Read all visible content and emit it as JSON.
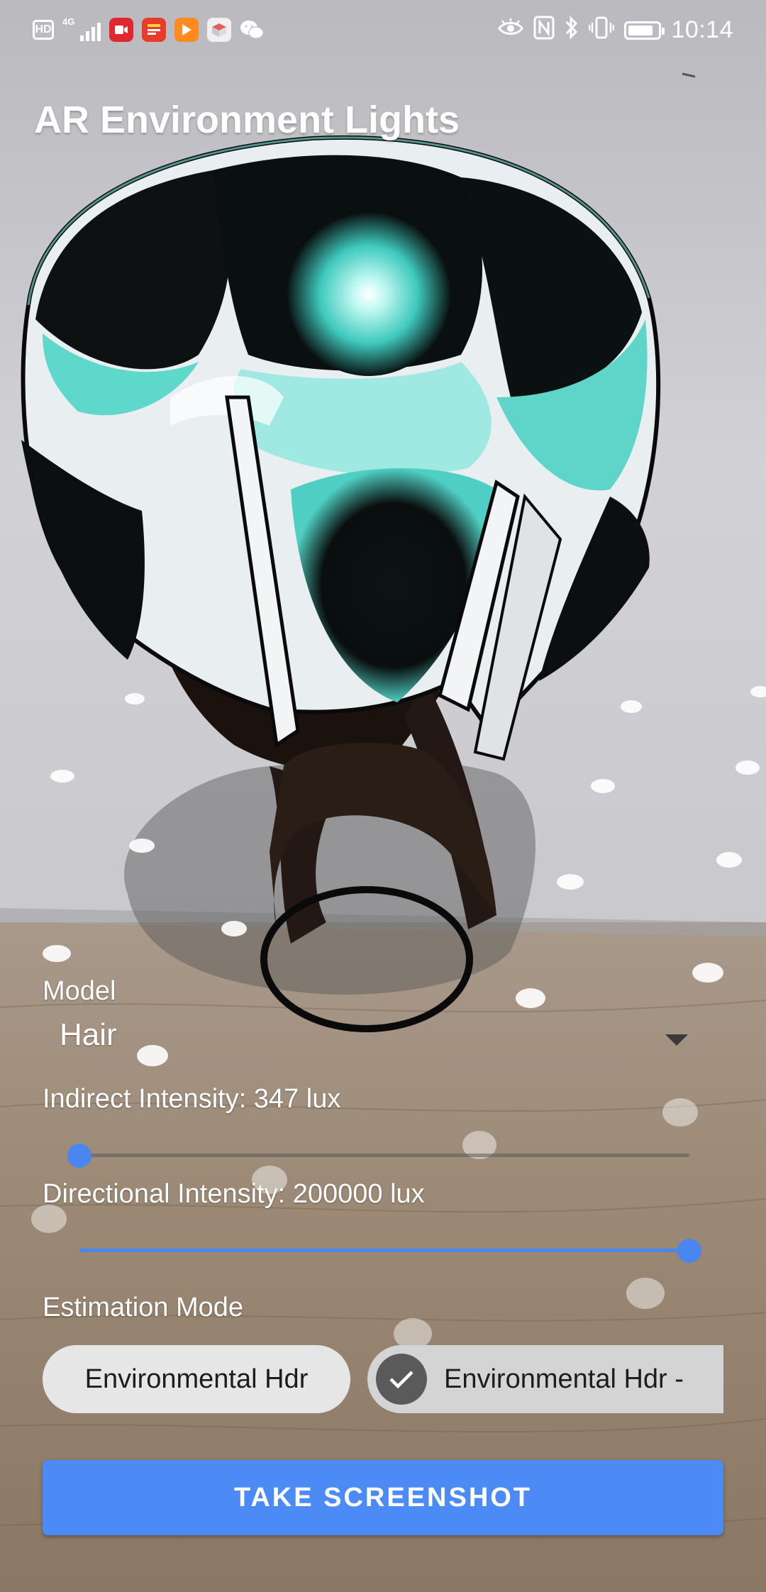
{
  "status_bar": {
    "hd_badge": "HD",
    "network_type": "4G",
    "time": "10:14",
    "battery_level": 0.85,
    "left_icons": [
      "hd-badge-icon",
      "signal-icon",
      "video-app-icon",
      "news-app-icon",
      "player-app-icon",
      "store-app-icon",
      "wechat-app-icon"
    ],
    "right_icons": [
      "eye-comfort-icon",
      "nfc-icon",
      "bluetooth-icon",
      "vibrate-icon",
      "battery-icon"
    ]
  },
  "app": {
    "title": "AR Environment Lights"
  },
  "controls": {
    "model_label": "Model",
    "model_value": "Hair",
    "indirect_label": "Indirect Intensity: 347 lux",
    "indirect_value_fraction": 0.0,
    "directional_label": "Directional Intensity: 200000 lux",
    "directional_value_fraction": 1.0,
    "estimation_label": "Estimation Mode",
    "mode_options": [
      {
        "label": "Environmental Hdr",
        "selected": false
      },
      {
        "label": "Environmental Hdr -",
        "selected": true
      }
    ],
    "screenshot_button": "TAKE SCREENSHOT"
  },
  "colors": {
    "accent": "#4c8bf5",
    "hair_glow": "#7ff0e4"
  }
}
